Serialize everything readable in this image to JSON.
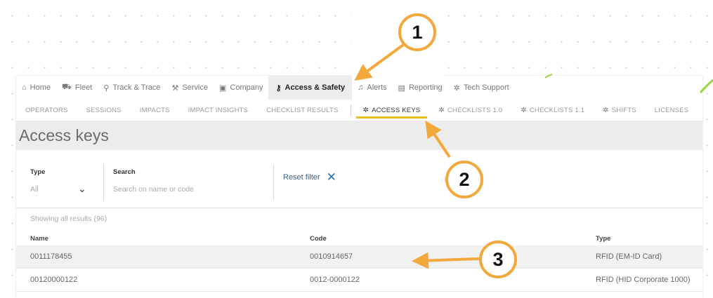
{
  "topnav": {
    "items": [
      {
        "label": "Home",
        "icon": "home-icon"
      },
      {
        "label": "Fleet",
        "icon": "forklift-icon"
      },
      {
        "label": "Track & Trace",
        "icon": "map-pin-icon"
      },
      {
        "label": "Service",
        "icon": "wrench-icon"
      },
      {
        "label": "Company",
        "icon": "building-icon"
      },
      {
        "label": "Access & Safety",
        "icon": "key-icon",
        "active": true
      },
      {
        "label": "Alerts",
        "icon": "bell-icon"
      },
      {
        "label": "Reporting",
        "icon": "report-icon"
      },
      {
        "label": "Tech Support",
        "icon": "gear-icon"
      }
    ]
  },
  "subnav": {
    "items": [
      {
        "label": "OPERATORS"
      },
      {
        "label": "SESSIONS"
      },
      {
        "label": "IMPACTS"
      },
      {
        "label": "IMPACT INSIGHTS"
      },
      {
        "label": "CHECKLIST RESULTS"
      },
      {
        "label": "ACCESS KEYS",
        "icon": "gear-icon",
        "active": true
      },
      {
        "label": "CHECKLISTS 1.0",
        "icon": "gear-icon"
      },
      {
        "label": "CHECKLISTS 1.1",
        "icon": "gear-icon"
      },
      {
        "label": "SHIFTS",
        "icon": "gear-icon"
      },
      {
        "label": "LICENSES"
      }
    ]
  },
  "page": {
    "title": "Access keys"
  },
  "filters": {
    "type_label": "Type",
    "type_value": "All",
    "search_label": "Search",
    "search_placeholder": "Search on name or code",
    "reset_label": "Reset filter"
  },
  "results": {
    "showing": "Showing all results (96)"
  },
  "table": {
    "columns": [
      "Name",
      "Code",
      "Type"
    ],
    "rows": [
      [
        "0011178455",
        "0010914657",
        "RFID (EM-ID Card)"
      ],
      [
        "00120000122",
        "0012-0000122",
        "RFID (HID Corporate 1000)"
      ]
    ]
  },
  "callouts": [
    "1",
    "2",
    "3"
  ],
  "colors": {
    "accent_underline": "#e8c21a",
    "callout_border": "#f3a83c",
    "link": "#3a5f8a"
  }
}
